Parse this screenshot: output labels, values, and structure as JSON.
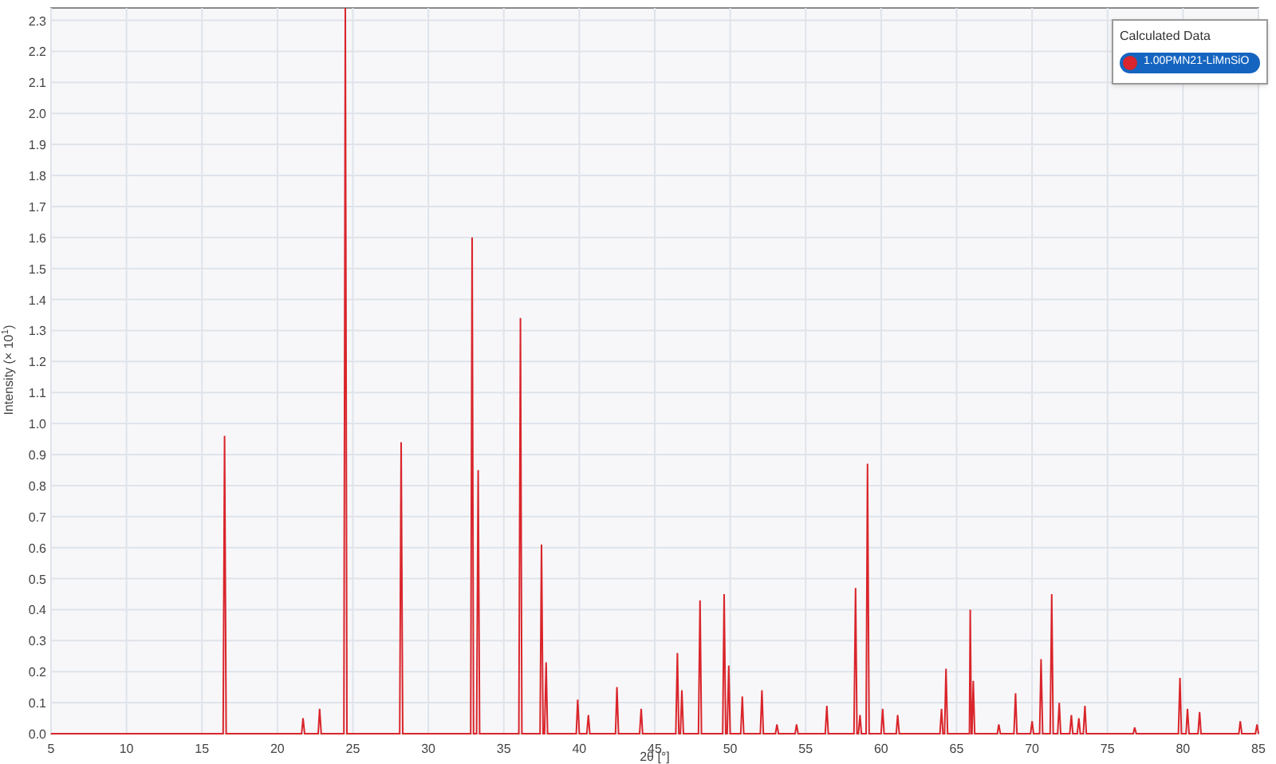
{
  "chart_data": {
    "type": "line",
    "grid": true,
    "xlabel": "2θ [°]",
    "ylabel": "Intensity (× 10$^{1}$)",
    "xlim": [
      5,
      85
    ],
    "ylim": [
      0,
      2.34
    ],
    "xticks": [
      5,
      10,
      15,
      20,
      25,
      30,
      35,
      40,
      45,
      50,
      55,
      60,
      65,
      70,
      75,
      80,
      85
    ],
    "yticks": [
      {
        "value": 0,
        "label": "0.0"
      },
      {
        "value": 0.1,
        "label": "0.1"
      },
      {
        "value": 0.2,
        "label": "0.2"
      },
      {
        "value": 0.3,
        "label": "0.3"
      },
      {
        "value": 0.4,
        "label": "0.4"
      },
      {
        "value": 0.5,
        "label": "0.5"
      },
      {
        "value": 0.6,
        "label": "0.6"
      },
      {
        "value": 0.7,
        "label": "0.7"
      },
      {
        "value": 0.8,
        "label": "0.8"
      },
      {
        "value": 0.9,
        "label": "0.9"
      },
      {
        "value": 1,
        "label": "1.0"
      },
      {
        "value": 1.1,
        "label": "1.1"
      },
      {
        "value": 1.2,
        "label": "1.2"
      },
      {
        "value": 1.3,
        "label": "1.3"
      },
      {
        "value": 1.4,
        "label": "1.4"
      },
      {
        "value": 1.5,
        "label": "1.5"
      },
      {
        "value": 1.6,
        "label": "1.6"
      },
      {
        "value": 1.7,
        "label": "1.7"
      },
      {
        "value": 1.8,
        "label": "1.8"
      },
      {
        "value": 1.9,
        "label": "1.9"
      },
      {
        "value": 2,
        "label": "2.0"
      },
      {
        "value": 2.1,
        "label": "2.1"
      },
      {
        "value": 2.2,
        "label": "2.2"
      },
      {
        "value": 2.3,
        "label": "2.3"
      }
    ],
    "x": [
      5,
      16.4,
      16.5,
      16.6,
      21.6,
      21.7,
      21.8,
      22.7,
      22.8,
      22.9,
      24.4,
      24.5,
      24.6,
      28.1,
      28.2,
      28.3,
      32.8,
      32.9,
      33.0,
      33.2,
      33.3,
      33.4,
      36.0,
      36.1,
      36.2,
      37.4,
      37.5,
      37.6,
      37.7,
      37.8,
      37.9,
      39.8,
      39.9,
      40.0,
      40.5,
      40.6,
      40.7,
      42.4,
      42.5,
      42.6,
      44.0,
      44.1,
      44.2,
      46.4,
      46.5,
      46.6,
      46.7,
      46.8,
      46.9,
      47.9,
      48.0,
      48.1,
      49.5,
      49.6,
      49.7,
      49.8,
      49.9,
      50.0,
      50.7,
      50.8,
      50.9,
      52.0,
      52.1,
      52.2,
      53.0,
      53.1,
      53.2,
      54.3,
      54.4,
      54.5,
      56.3,
      56.4,
      56.5,
      58.2,
      58.3,
      58.4,
      58.5,
      58.6,
      58.7,
      59.0,
      59.1,
      59.2,
      60.0,
      60.1,
      60.2,
      61.0,
      61.1,
      61.2,
      63.9,
      64.0,
      64.1,
      64.2,
      64.3,
      64.4,
      65.85,
      65.9,
      65.98,
      66.02,
      66.1,
      66.2,
      67.7,
      67.8,
      67.9,
      68.8,
      68.9,
      69.0,
      69.9,
      70.0,
      70.1,
      70.5,
      70.6,
      70.7,
      71.2,
      71.3,
      71.4,
      71.7,
      71.8,
      71.9,
      72.5,
      72.6,
      72.7,
      73.0,
      73.1,
      73.2,
      73.4,
      73.5,
      73.6,
      76.7,
      76.8,
      76.9,
      79.7,
      79.8,
      79.9,
      80.2,
      80.3,
      80.4,
      81.0,
      81.1,
      81.2,
      83.7,
      83.8,
      83.9,
      84.8,
      84.9,
      85
    ],
    "series": [
      {
        "name": "1.00PMN21-LiMnSiO",
        "color": "#d9252b",
        "values": [
          0,
          0,
          0.96,
          0,
          0,
          0.05,
          0,
          0,
          0.08,
          0,
          0,
          2.34,
          0,
          0,
          0.94,
          0,
          0,
          1.6,
          0,
          0,
          0.85,
          0,
          0,
          1.34,
          0,
          0,
          0.61,
          0,
          0,
          0.23,
          0,
          0,
          0.11,
          0,
          0,
          0.06,
          0,
          0,
          0.15,
          0,
          0,
          0.08,
          0,
          0,
          0.26,
          0,
          0,
          0.14,
          0,
          0,
          0.43,
          0,
          0,
          0.45,
          0,
          0,
          0.22,
          0,
          0,
          0.12,
          0,
          0,
          0.14,
          0,
          0,
          0.03,
          0,
          0,
          0.03,
          0,
          0,
          0.09,
          0,
          0,
          0.47,
          0,
          0,
          0.06,
          0,
          0,
          0.87,
          0,
          0,
          0.08,
          0,
          0,
          0.06,
          0,
          0,
          0.08,
          0,
          0,
          0.21,
          0,
          0,
          0.4,
          0,
          0,
          0.17,
          0,
          0,
          0.03,
          0,
          0,
          0.13,
          0,
          0,
          0.04,
          0,
          0,
          0.24,
          0,
          0,
          0.45,
          0,
          0,
          0.1,
          0,
          0,
          0.06,
          0,
          0,
          0.05,
          0,
          0,
          0.09,
          0,
          0,
          0.02,
          0,
          0,
          0.18,
          0,
          0,
          0.08,
          0,
          0,
          0.07,
          0,
          0,
          0.04,
          0,
          0,
          0.03,
          0
        ]
      }
    ]
  },
  "legend": {
    "title": "Calculated Data",
    "items": [
      {
        "selected": true
      }
    ]
  }
}
